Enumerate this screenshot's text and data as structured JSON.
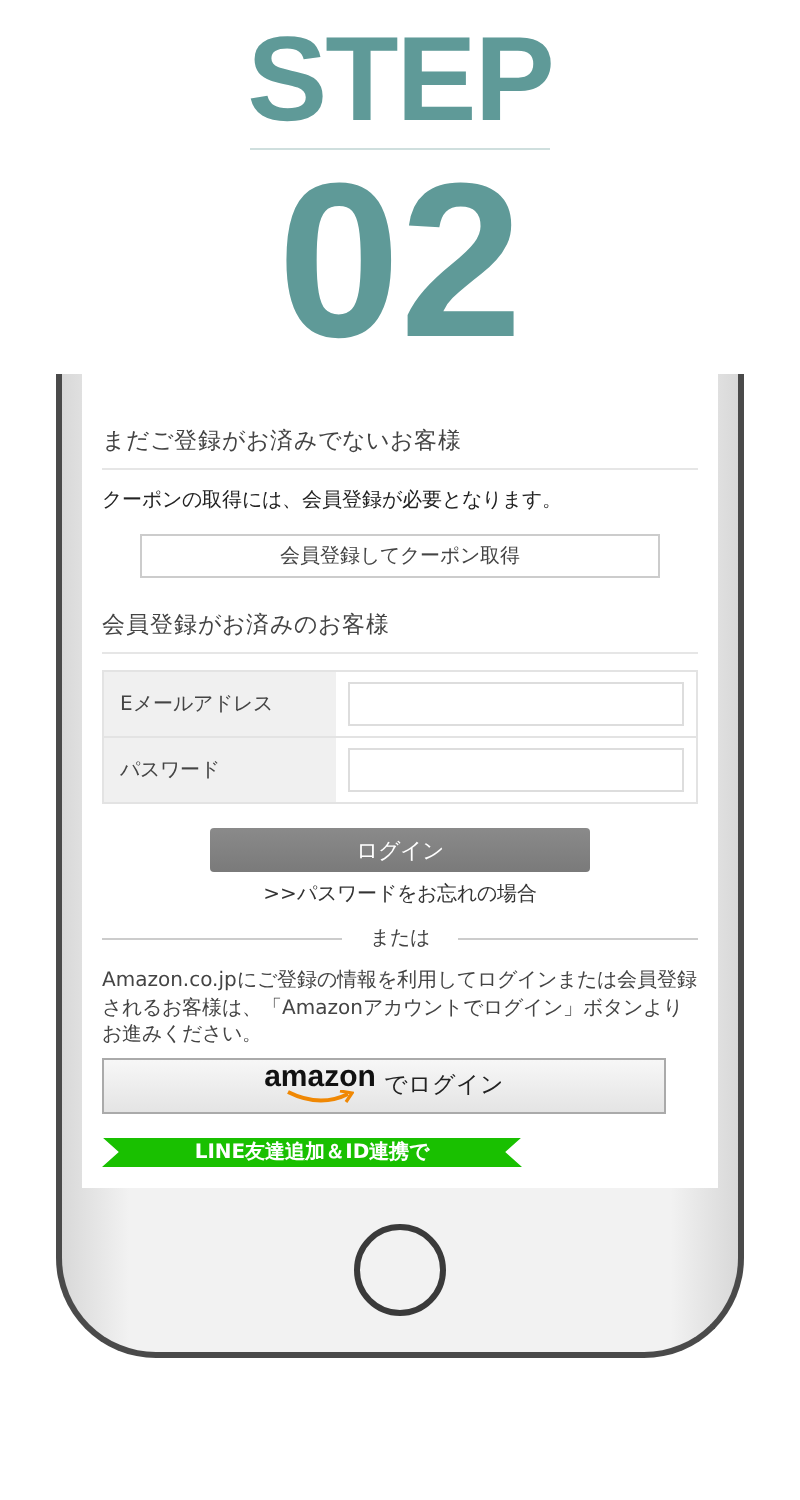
{
  "header": {
    "step_label": "STEP",
    "step_number": "02"
  },
  "unregistered": {
    "heading": "まだご登録がお済みでないお客様",
    "note": "クーポンの取得には、会員登録が必要となります。",
    "register_button": "会員登録してクーポン取得"
  },
  "registered": {
    "heading": "会員登録がお済みのお客様",
    "fields": [
      {
        "label": "Eメールアドレス"
      },
      {
        "label": "パスワード"
      }
    ],
    "login_button": "ログイン",
    "forgot_link": ">>パスワードをお忘れの場合"
  },
  "divider_label": "または",
  "amazon": {
    "note": "Amazon.co.jpにご登録の情報を利用してログインまたは会員登録されるお客様は、「Amazonアカウントでログイン」ボタンよりお進みください。",
    "logo": "amazon",
    "button_label": "でログイン"
  },
  "line_banner": "LINE友達追加＆ID連携で"
}
